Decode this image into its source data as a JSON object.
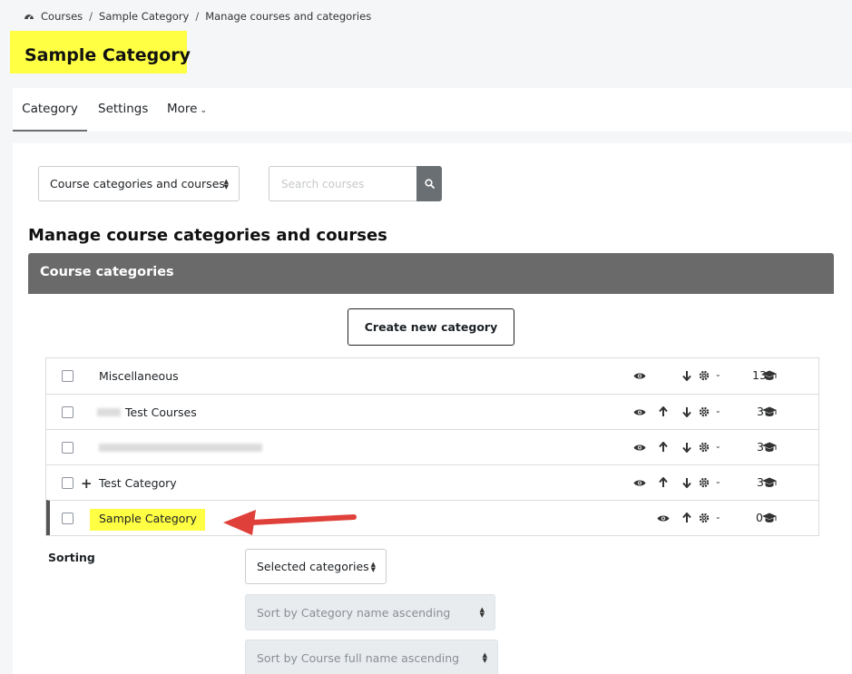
{
  "breadcrumb": {
    "items": [
      "Courses",
      "Sample Category",
      "Manage courses and categories"
    ],
    "separator": "/"
  },
  "page": {
    "title": "Sample Category"
  },
  "tabs": [
    {
      "label": "Category",
      "active": true
    },
    {
      "label": "Settings",
      "active": false
    },
    {
      "label": "More",
      "active": false
    }
  ],
  "toolbar": {
    "view_select": "Course categories and courses",
    "search_placeholder": "Search courses"
  },
  "main": {
    "heading": "Manage course categories and courses",
    "panel_title": "Course categories",
    "create_button": "Create new category"
  },
  "categories": [
    {
      "name": "Miscellaneous",
      "count": "13"
    },
    {
      "name": "Test Courses",
      "count": "3"
    },
    {
      "name": "",
      "count": "3"
    },
    {
      "name": "Test Category",
      "count": "3"
    },
    {
      "name": "Sample Category",
      "count": "0"
    }
  ],
  "sorting": {
    "label": "Sorting",
    "scope": "Selected categories",
    "category_sort": "Sort by Category name ascending",
    "course_sort": "Sort by Course full name ascending"
  },
  "colors": {
    "highlight": "#ffff44",
    "panel_header": "#6a6a6a",
    "annotation_arrow": "#e0403a"
  }
}
